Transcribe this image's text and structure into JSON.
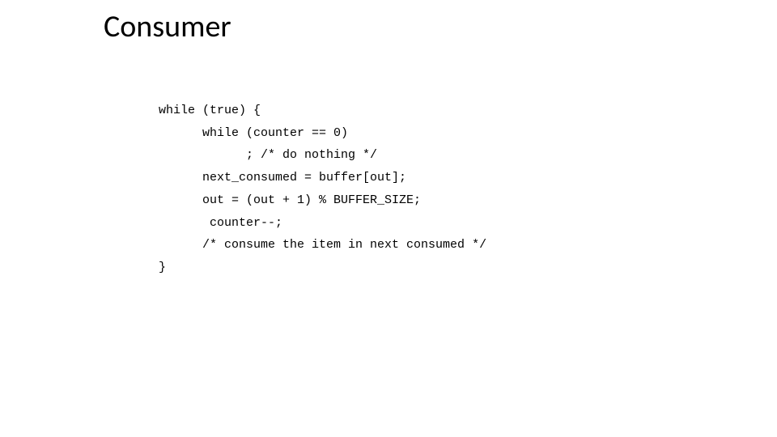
{
  "title": "Consumer",
  "code": {
    "line1": "while (true) {",
    "line2": "      while (counter == 0) ",
    "line3": "            ; /* do nothing */",
    "line4": "      next_consumed = buffer[out]; ",
    "line5": "      out = (out + 1) % BUFFER_SIZE;",
    "line6": "       counter--; ",
    "line7": "      /* consume the item in next consumed */ ",
    "line8": "}"
  }
}
